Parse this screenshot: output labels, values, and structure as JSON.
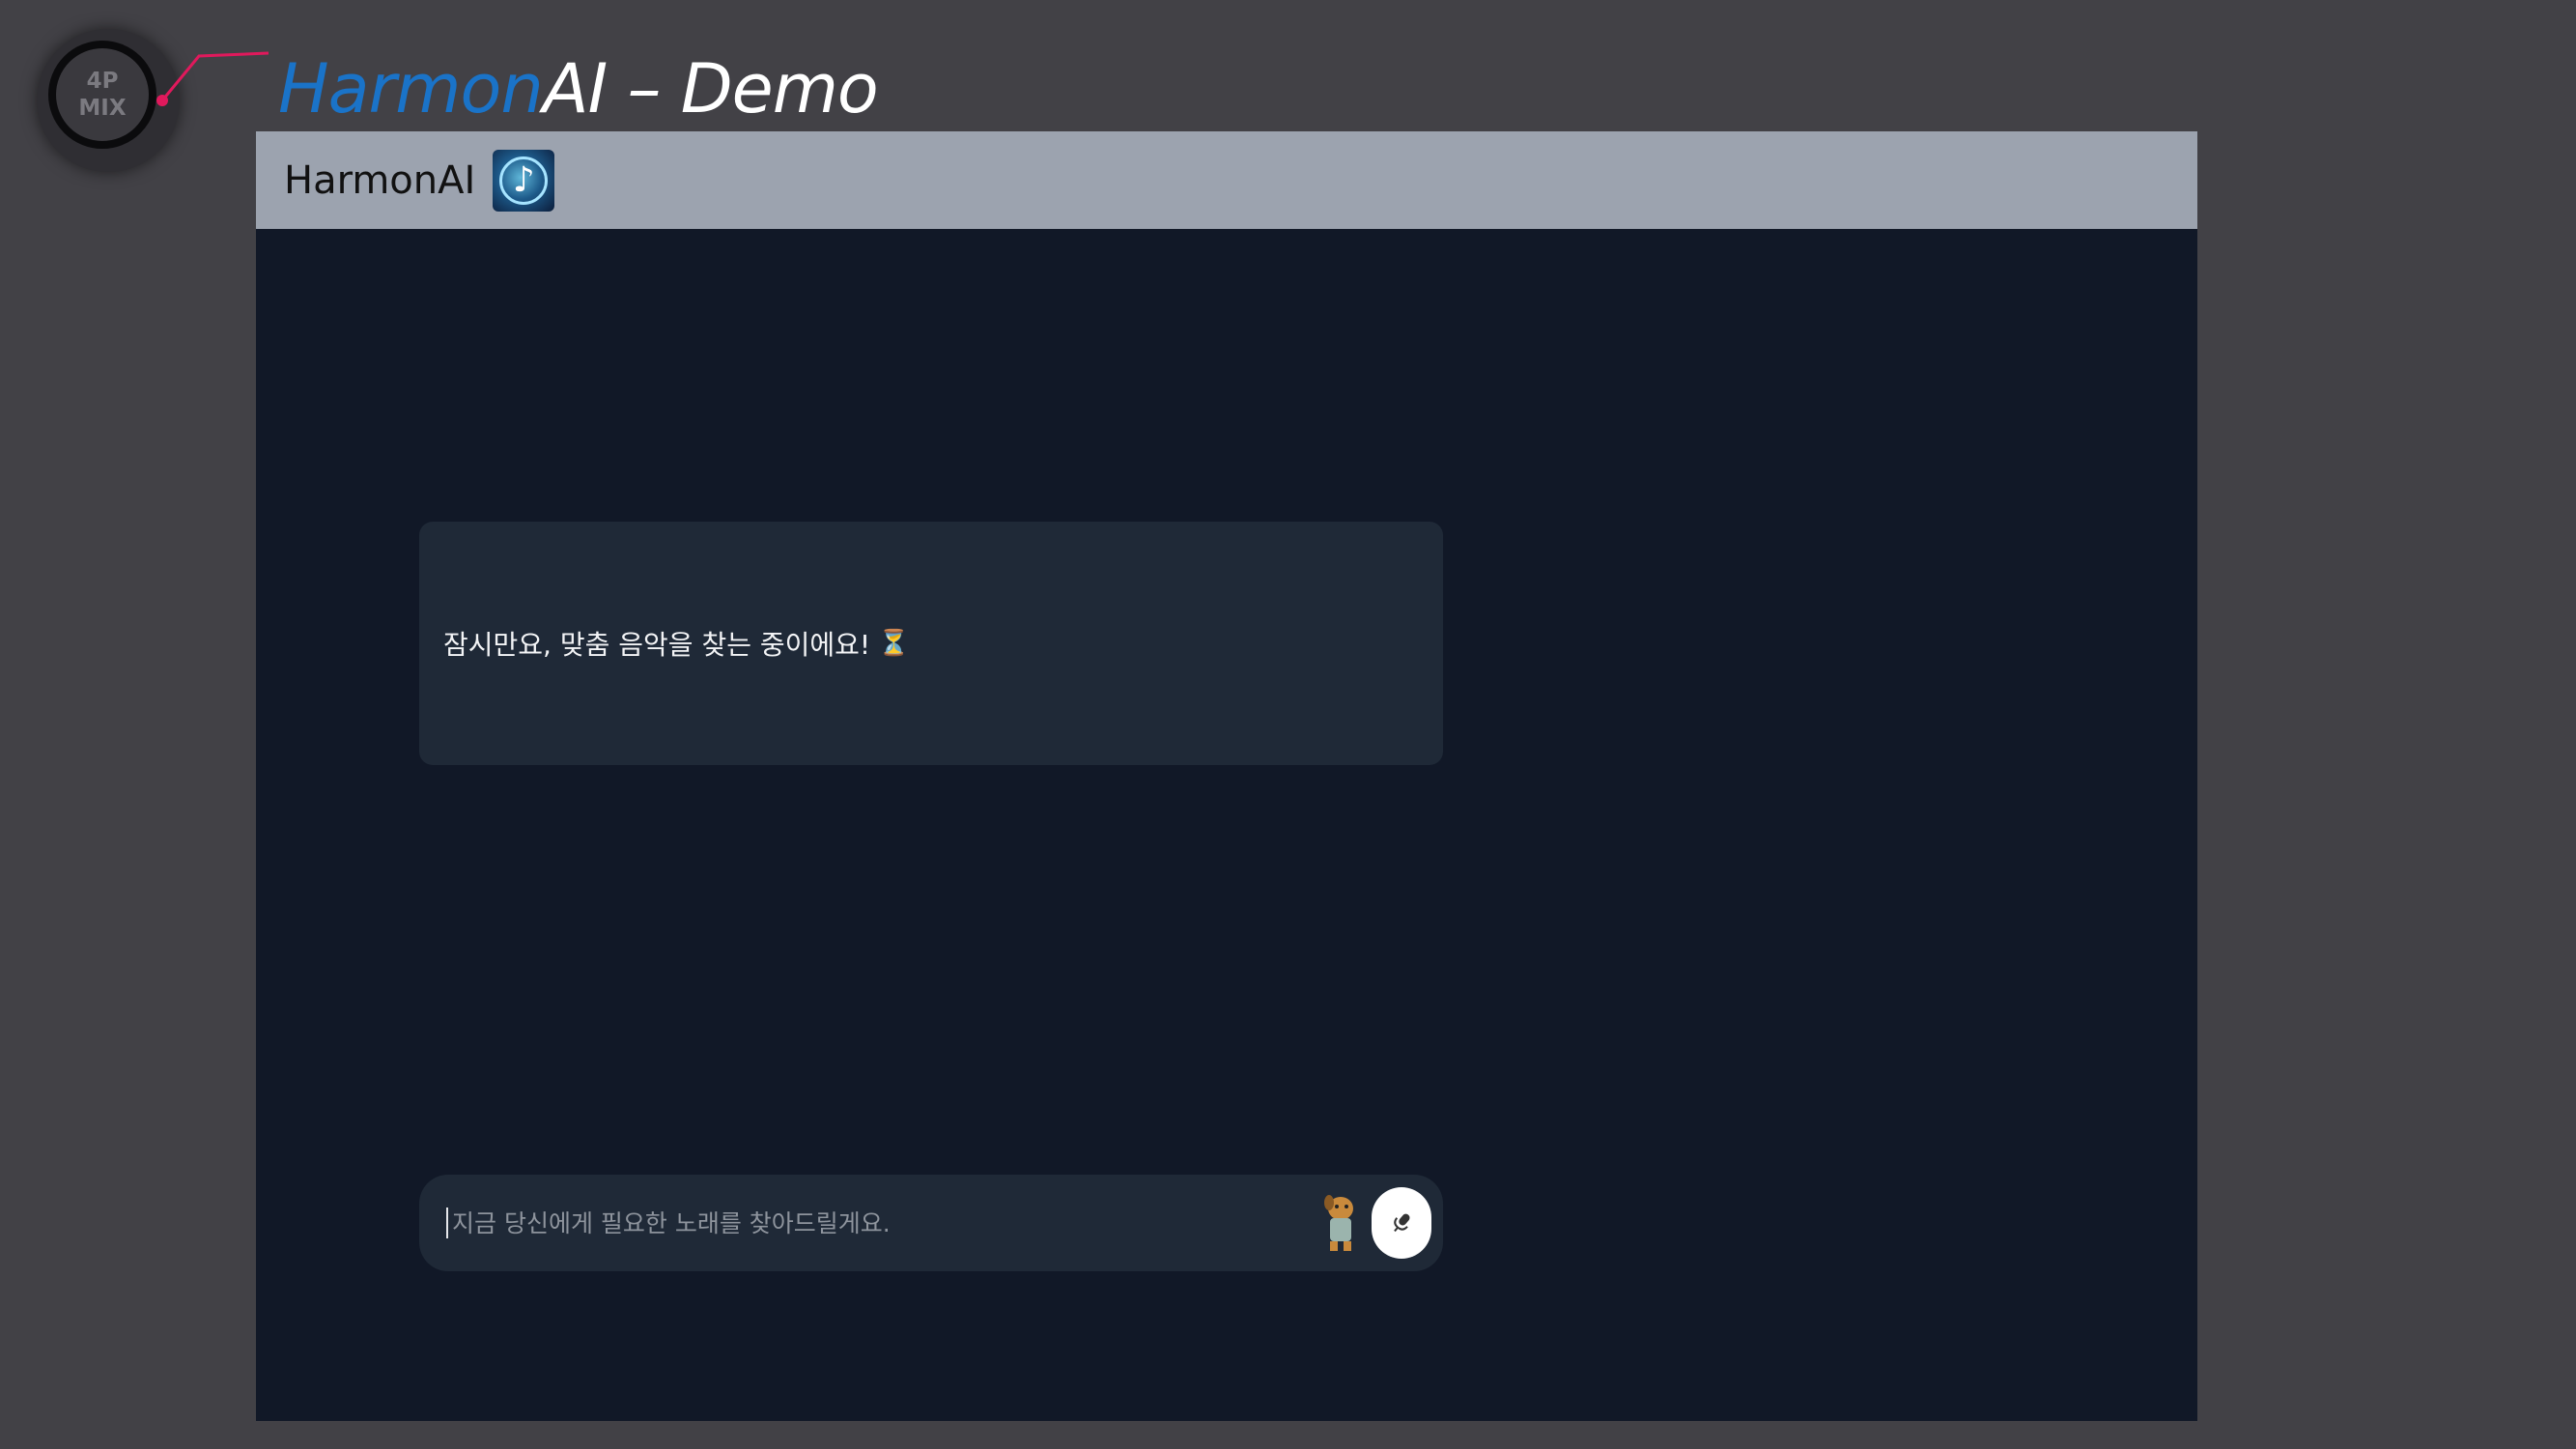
{
  "badge": {
    "line1": "4P",
    "line2": "MIX"
  },
  "page_title": {
    "accent": "Harmon",
    "rest": "AI – Demo"
  },
  "header": {
    "app_name": "HarmonAI"
  },
  "message": {
    "text": "잠시만요, 맞춤 음악을 찾는 중이에요!"
  },
  "input": {
    "placeholder": "지금 당신에게 필요한 노래를 찾아드릴게요."
  },
  "colors": {
    "page_bg": "#424146",
    "app_bg": "#111827",
    "header_bg": "#9ca3af",
    "card_bg": "#1f2937",
    "title_accent": "#1a73c8",
    "connector": "#e0195c"
  },
  "icons": {
    "logo": "music-note-disc-icon",
    "hourglass": "hourglass-icon",
    "mascot": "dog-mascot-icon",
    "mic": "microphone-icon"
  }
}
